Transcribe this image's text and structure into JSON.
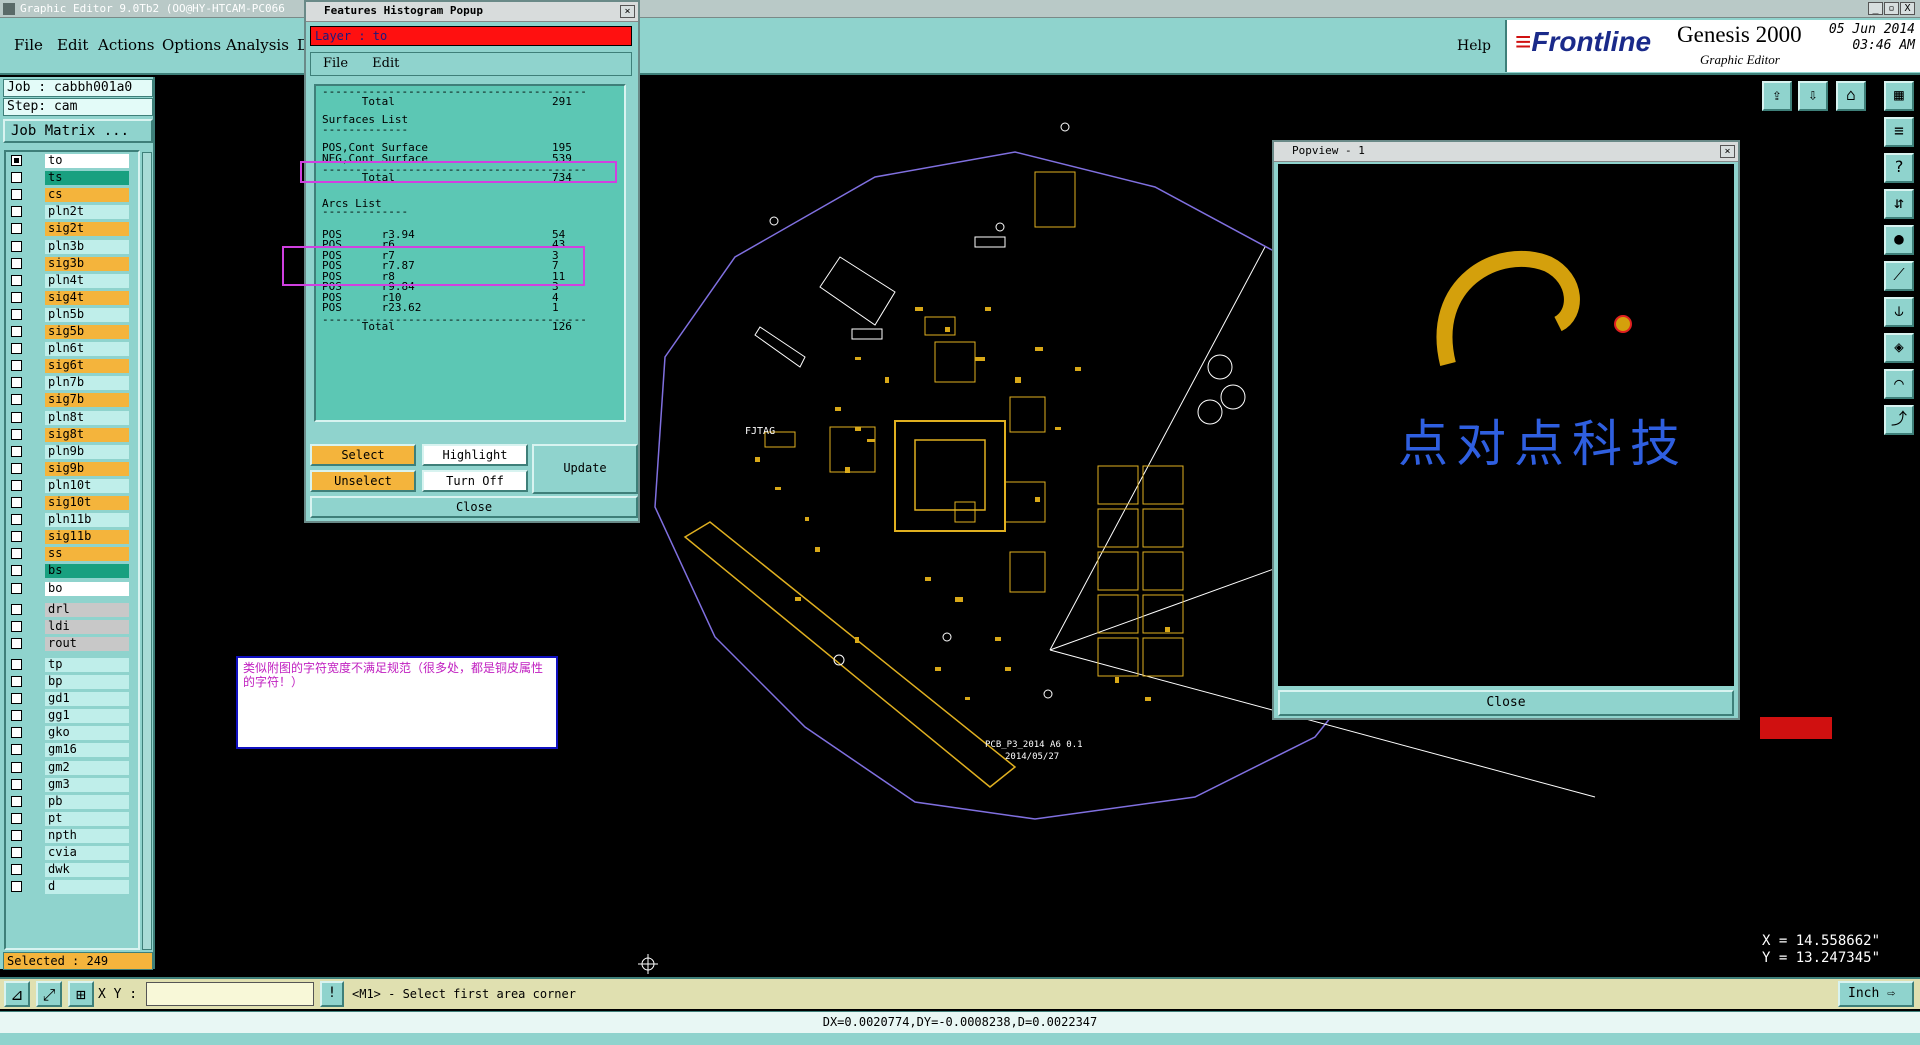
{
  "window": {
    "title": "Graphic Editor 9.0Tb2  (OO@HY-HTCAM-PC066",
    "controls": [
      "_",
      "▫",
      "X"
    ]
  },
  "menu": {
    "items": [
      "File",
      "Edit",
      "Actions",
      "Options",
      "Analysis",
      "D"
    ],
    "help": "Help"
  },
  "brand": {
    "logo": "Frontline",
    "product": "Genesis 2000",
    "subtitle": "Graphic Editor",
    "date": "05 Jun 2014",
    "time": "03:46 AM"
  },
  "left_panel": {
    "job": "Job : cabbh001a0",
    "step": "Step: cam",
    "job_matrix": "Job Matrix ...",
    "selected": "Selected : 249",
    "layers": [
      {
        "name": "to",
        "style": "white",
        "checked": true
      },
      {
        "name": "ts",
        "style": "teal2",
        "checked": false
      },
      {
        "name": "cs",
        "style": "orange",
        "checked": false
      },
      {
        "name": "pln2t",
        "style": "lt",
        "checked": false
      },
      {
        "name": "sig2t",
        "style": "orange",
        "checked": false
      },
      {
        "name": "pln3b",
        "style": "lt",
        "checked": false
      },
      {
        "name": "sig3b",
        "style": "orange",
        "checked": false
      },
      {
        "name": "pln4t",
        "style": "lt",
        "checked": false
      },
      {
        "name": "sig4t",
        "style": "orange",
        "checked": false
      },
      {
        "name": "pln5b",
        "style": "lt",
        "checked": false
      },
      {
        "name": "sig5b",
        "style": "orange",
        "checked": false
      },
      {
        "name": "pln6t",
        "style": "lt",
        "checked": false
      },
      {
        "name": "sig6t",
        "style": "orange",
        "checked": false
      },
      {
        "name": "pln7b",
        "style": "lt",
        "checked": false
      },
      {
        "name": "sig7b",
        "style": "orange",
        "checked": false
      },
      {
        "name": "pln8t",
        "style": "lt",
        "checked": false
      },
      {
        "name": "sig8t",
        "style": "orange",
        "checked": false
      },
      {
        "name": "pln9b",
        "style": "lt",
        "checked": false
      },
      {
        "name": "sig9b",
        "style": "orange",
        "checked": false
      },
      {
        "name": "pln10t",
        "style": "lt",
        "checked": false
      },
      {
        "name": "sig10t",
        "style": "orange",
        "checked": false
      },
      {
        "name": "pln11b",
        "style": "lt",
        "checked": false
      },
      {
        "name": "sig11b",
        "style": "orange",
        "checked": false
      },
      {
        "name": "ss",
        "style": "orange",
        "checked": false
      },
      {
        "name": "bs",
        "style": "teal2",
        "checked": false
      },
      {
        "name": "bo",
        "style": "white",
        "checked": false
      },
      {
        "name": "drl",
        "style": "gray",
        "checked": false
      },
      {
        "name": "ldi",
        "style": "gray",
        "checked": false
      },
      {
        "name": "rout",
        "style": "gray",
        "checked": false
      },
      {
        "name": "tp",
        "style": "lt",
        "checked": false
      },
      {
        "name": "bp",
        "style": "lt",
        "checked": false
      },
      {
        "name": "gd1",
        "style": "lt",
        "checked": false
      },
      {
        "name": "gg1",
        "style": "lt",
        "checked": false
      },
      {
        "name": "gko",
        "style": "lt",
        "checked": false
      },
      {
        "name": "gm16",
        "style": "lt",
        "checked": false
      },
      {
        "name": "gm2",
        "style": "lt",
        "checked": false
      },
      {
        "name": "gm3",
        "style": "lt",
        "checked": false
      },
      {
        "name": "pb",
        "style": "lt",
        "checked": false
      },
      {
        "name": "pt",
        "style": "lt",
        "checked": false
      },
      {
        "name": "npth",
        "style": "lt",
        "checked": false
      },
      {
        "name": "cvia",
        "style": "lt",
        "checked": false
      },
      {
        "name": "dwk",
        "style": "lt",
        "checked": false
      },
      {
        "name": "d",
        "style": "lt",
        "checked": false
      }
    ]
  },
  "features_popup": {
    "title": "Features Histogram Popup",
    "layer_label": "Layer :  to",
    "menu": [
      "File",
      "Edit"
    ],
    "lines": [
      {
        "label": "      Total",
        "value": "291",
        "y": 0
      },
      {
        "label": "Surfaces List",
        "value": "",
        "y": 1
      },
      {
        "label": "POS,Cont Surface",
        "value": "195",
        "y": 2
      },
      {
        "label": "NEG,Cont Surface",
        "value": "539",
        "y": 3
      },
      {
        "label": "      Total",
        "value": "734",
        "y": 4
      },
      {
        "label": "Arcs List",
        "value": "",
        "y": 5
      },
      {
        "label": "POS      r3.94",
        "value": "54",
        "y": 6
      },
      {
        "label": "POS      r6",
        "value": "43",
        "y": 7
      },
      {
        "label": "POS      r7",
        "value": "3",
        "y": 8
      },
      {
        "label": "POS      r7.87",
        "value": "7",
        "y": 9
      },
      {
        "label": "POS      r8",
        "value": "11",
        "y": 10
      },
      {
        "label": "POS      r9.84",
        "value": "3",
        "y": 11
      },
      {
        "label": "POS      r10",
        "value": "4",
        "y": 12
      },
      {
        "label": "POS      r23.62",
        "value": "1",
        "y": 13
      },
      {
        "label": "      Total",
        "value": "126",
        "y": 14
      }
    ],
    "buttons": {
      "select": "Select",
      "highlight": "Highlight",
      "update": "Update",
      "unselect": "Unselect",
      "turn_off": "Turn Off",
      "close": "Close"
    }
  },
  "popview": {
    "title": "Popview - 1",
    "logo_text": "点对点科技",
    "close": "Close"
  },
  "note": {
    "text": "类似附图的字符宽度不满足规范（很多处，都是铜皮属性的字符！）"
  },
  "board_text": {
    "label1": "FJTAG",
    "label2": "PCB_P3_2014 A6 0.1",
    "label3": "2014/05/27"
  },
  "command_bar": {
    "xy_label": "X Y :",
    "xy_value": "",
    "prompt": "<M1> - Select first area corner",
    "units": "Inch"
  },
  "status_bar": {
    "text": "DX=0.0020774,DY=-0.0008238,D=0.0022347"
  },
  "coords": {
    "x": "X = 14.558662\"",
    "y": "Y = 13.247345\""
  }
}
